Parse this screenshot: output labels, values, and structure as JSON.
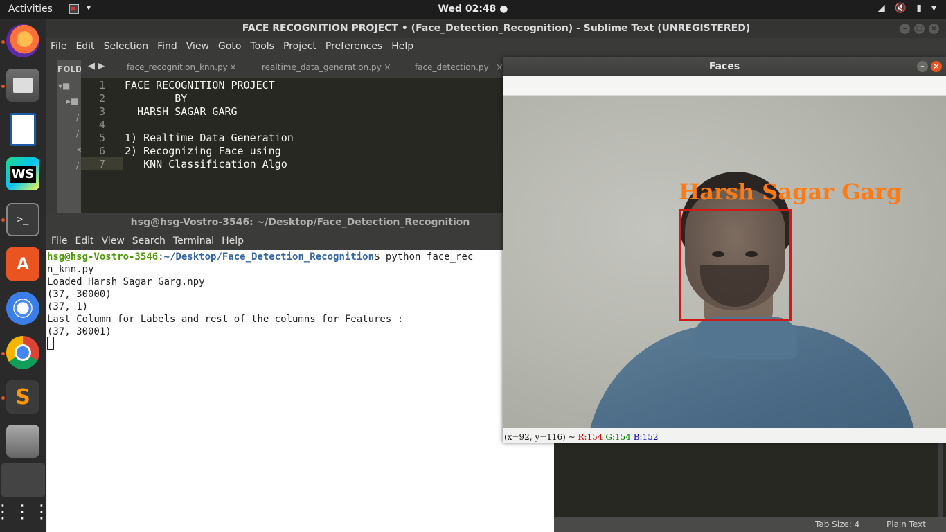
{
  "topbar": {
    "activities": "Activities",
    "clock": "Wed 02:48 ●",
    "tray_icons": [
      "network-icon",
      "volume-muted-icon",
      "battery-icon",
      "system-menu-caret-icon"
    ]
  },
  "dock": {
    "apps": [
      "firefox-icon",
      "files-icon",
      "libreoffice-writer-icon",
      "webstorm-icon",
      "terminal-icon",
      "ubuntu-software-icon",
      "chromium-icon",
      "chrome-icon",
      "sublime-text-icon",
      "scanner-icon",
      "active-app-icon",
      "show-applications-icon"
    ],
    "webstorm_label": "WS",
    "terminal_label": ">_",
    "software_label": "A",
    "sublime_label": "S",
    "grid_label": "⋮⋮⋮"
  },
  "sublime": {
    "title": "FACE RECOGNITION PROJECT • (Face_Detection_Recognition) - Sublime Text (UNREGISTERED)",
    "menu": [
      "File",
      "Edit",
      "Selection",
      "Find",
      "View",
      "Goto",
      "Tools",
      "Project",
      "Preferences",
      "Help"
    ],
    "sidebar_heading": "FOLD",
    "tabs": [
      {
        "label": "face_recognition_knn.py"
      },
      {
        "label": "realtime_data_generation.py"
      },
      {
        "label": "face_detection.py"
      }
    ],
    "tab_close": "×",
    "tab_nav": "◀ ▶",
    "code_lines": [
      {
        "n": "1",
        "text": "FACE RECOGNITION PROJECT"
      },
      {
        "n": "2",
        "text": "        BY"
      },
      {
        "n": "3",
        "text": "  HARSH SAGAR GARG"
      },
      {
        "n": "4",
        "text": ""
      },
      {
        "n": "5",
        "text": "1) Realtime Data Generation"
      },
      {
        "n": "6",
        "text": "2) Recognizing Face using"
      },
      {
        "n": "7",
        "text": "   KNN Classification Algo"
      }
    ],
    "status": {
      "tab_size": "Tab Size: 4",
      "syntax": "Plain Text"
    }
  },
  "terminal": {
    "title": "hsg@hsg-Vostro-3546: ~/Desktop/Face_Detection_Recognition",
    "menu": [
      "File",
      "Edit",
      "View",
      "Search",
      "Terminal",
      "Help"
    ],
    "prompt_user": "hsg@hsg-Vostro-3546",
    "prompt_sep": ":",
    "prompt_path": "~/Desktop/Face_Detection_Recognition",
    "prompt_cmd": "$ python face_rec",
    "lines": [
      "n_knn.py",
      "Loaded Harsh Sagar Garg.npy",
      "(37, 30000)",
      "(37, 1)",
      "Last Column for Labels and rest of the columns for Features :",
      "(37, 30001)"
    ]
  },
  "faces": {
    "title": "Faces",
    "label": "Harsh Sagar Garg",
    "status_pos": "(x=92, y=116) ~ ",
    "status_r": "R:154",
    "status_g": "G:154",
    "status_b": "B:152",
    "colors": {
      "box": "#d01a1a",
      "label": "#ff7a12"
    }
  }
}
